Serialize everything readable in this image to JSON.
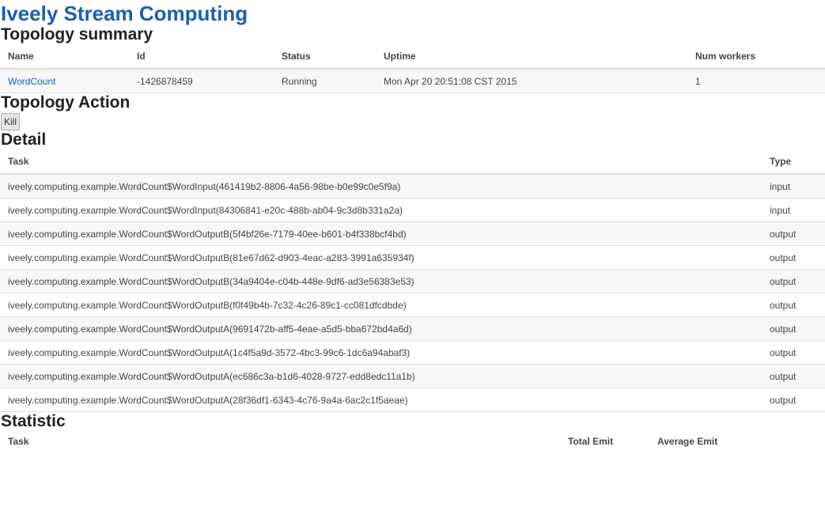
{
  "app": {
    "title": "Iveely Stream Computing"
  },
  "summary": {
    "title": "Topology summary",
    "headers": [
      "Name",
      "Id",
      "Status",
      "Uptime",
      "Num workers"
    ],
    "row": {
      "name": "WordCount",
      "id": "-1426878459",
      "status": "Running",
      "uptime": "Mon Apr 20 20:51:08 CST 2015",
      "workers": "1"
    }
  },
  "action": {
    "title": "Topology Action",
    "kill_label": "Kill"
  },
  "detail": {
    "title": "Detail",
    "headers": [
      "Task",
      "Type"
    ],
    "rows": [
      {
        "task": "iveely.computing.example.WordCount$WordInput(461419b2-8806-4a56-98be-b0e99c0e5f9a)",
        "type": "input"
      },
      {
        "task": "iveely.computing.example.WordCount$WordInput(84306841-e20c-488b-ab04-9c3d8b331a2a)",
        "type": "input"
      },
      {
        "task": "iveely.computing.example.WordCount$WordOutputB(5f4bf26e-7179-40ee-b601-b4f338bcf4bd)",
        "type": "output"
      },
      {
        "task": "iveely.computing.example.WordCount$WordOutputB(81e67d62-d903-4eac-a283-3991a635934f)",
        "type": "output"
      },
      {
        "task": "iveely.computing.example.WordCount$WordOutputB(34a9404e-c04b-448e-9df6-ad3e56383e53)",
        "type": "output"
      },
      {
        "task": "iveely.computing.example.WordCount$WordOutputB(f0f49b4b-7c32-4c26-89c1-cc081dfcdbde)",
        "type": "output"
      },
      {
        "task": "iveely.computing.example.WordCount$WordOutputA(9691472b-aff5-4eae-a5d5-bba672bd4a6d)",
        "type": "output"
      },
      {
        "task": "iveely.computing.example.WordCount$WordOutputA(1c4f5a9d-3572-4bc3-99c6-1dc6a94abaf3)",
        "type": "output"
      },
      {
        "task": "iveely.computing.example.WordCount$WordOutputA(ec686c3a-b1d6-4028-9727-edd8edc11a1b)",
        "type": "output"
      },
      {
        "task": "iveely.computing.example.WordCount$WordOutputA(28f36df1-6343-4c76-9a4a-6ac2c1f5aeae)",
        "type": "output"
      }
    ]
  },
  "statistic": {
    "title": "Statistic",
    "headers": [
      "Task",
      "Total Emit",
      "Average Emit"
    ]
  },
  "colors": {
    "title": "#1a5fb4",
    "link": "#1a5fb4",
    "stripe": "#f7f7f7",
    "border": "#dddddd"
  }
}
